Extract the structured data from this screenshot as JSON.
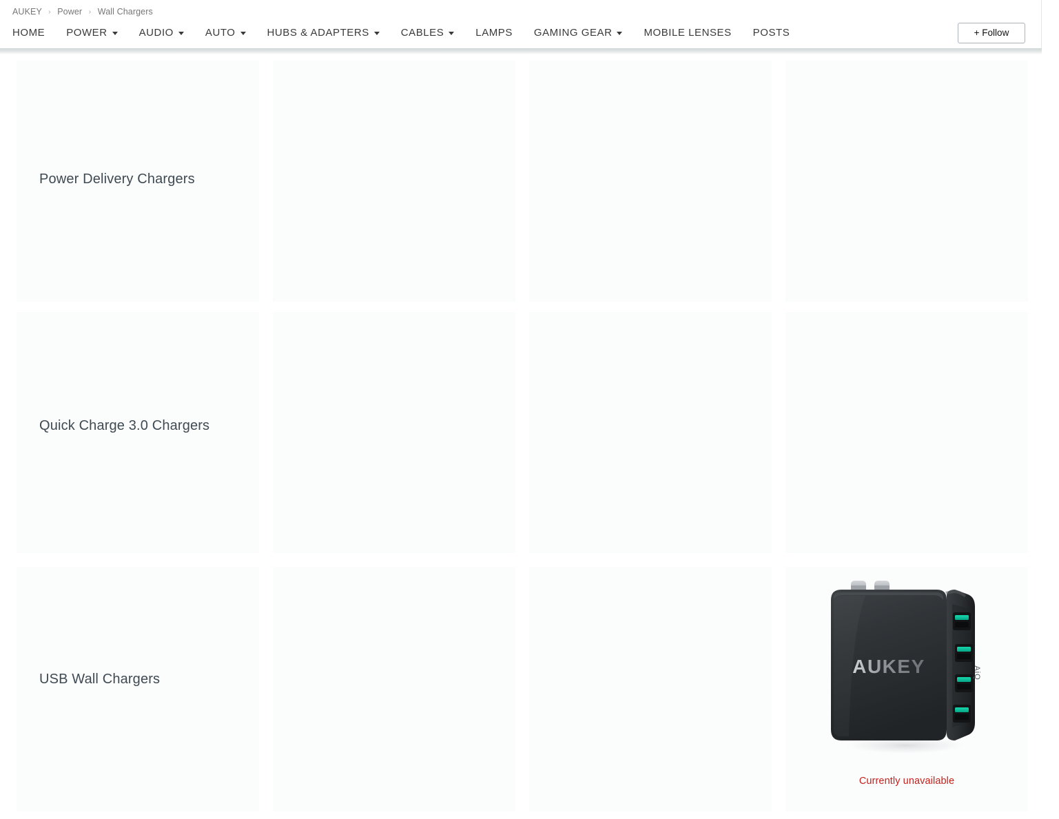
{
  "breadcrumb": {
    "items": [
      {
        "label": "AUKEY"
      },
      {
        "label": "Power"
      },
      {
        "label": "Wall Chargers"
      }
    ],
    "separator": "›"
  },
  "nav": {
    "items": [
      {
        "label": "HOME",
        "has_dropdown": false
      },
      {
        "label": "POWER",
        "has_dropdown": true
      },
      {
        "label": "AUDIO",
        "has_dropdown": true
      },
      {
        "label": "AUTO",
        "has_dropdown": true
      },
      {
        "label": "HUBS & ADAPTERS",
        "has_dropdown": true
      },
      {
        "label": "CABLES",
        "has_dropdown": true
      },
      {
        "label": "LAMPS",
        "has_dropdown": false
      },
      {
        "label": "GAMING GEAR",
        "has_dropdown": true
      },
      {
        "label": "MOBILE LENSES",
        "has_dropdown": false
      },
      {
        "label": "POSTS",
        "has_dropdown": false
      }
    ],
    "follow_label": "+ Follow"
  },
  "grid": {
    "rows": [
      {
        "title": "Power Delivery Chargers"
      },
      {
        "title": "Quick Charge 3.0 Chargers"
      },
      {
        "title": "USB Wall Chargers"
      }
    ]
  },
  "product": {
    "brand_text": "AUKEY",
    "side_text": "AiQ",
    "status": "Currently unavailable",
    "status_color": "#c7201b",
    "body_color": "#2e3134",
    "port_color": "#11c5a0",
    "prong_color": "#b9bcc0"
  },
  "colors": {
    "cell_background": "#fbfcfc",
    "page_background": "#ffffff",
    "nav_text": "#3a3a3a",
    "breadcrumb_text": "#767676",
    "title_text": "#3f4a52"
  }
}
